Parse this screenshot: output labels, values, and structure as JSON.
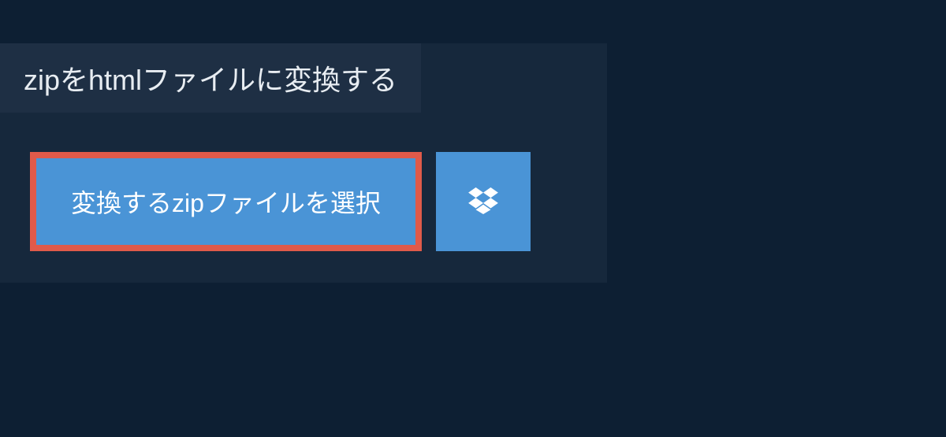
{
  "heading": {
    "title": "zipをhtmlファイルに変換する"
  },
  "buttons": {
    "select_file_label": "変換するzipファイルを選択"
  }
}
